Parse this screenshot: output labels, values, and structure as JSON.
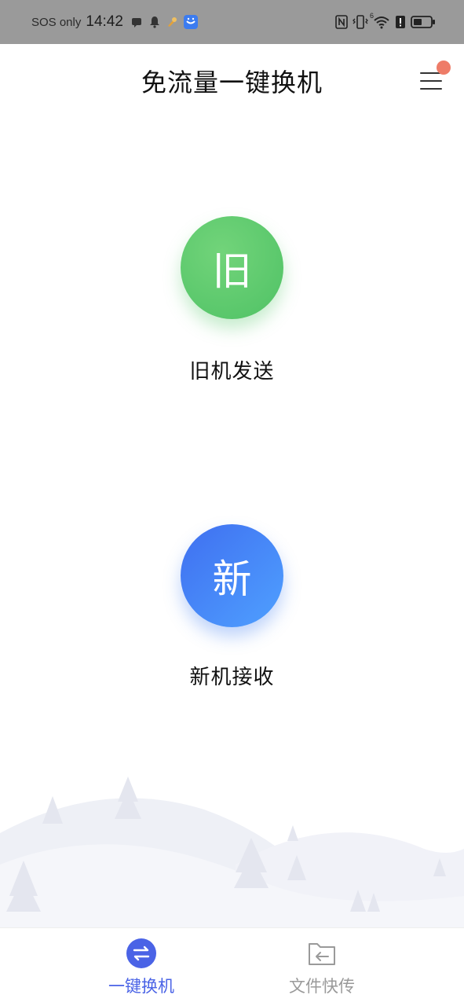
{
  "status_bar": {
    "carrier": "SOS only",
    "time": "14:42",
    "left_icons": [
      "message-icon",
      "bell-icon",
      "brush-icon",
      "app-badge-icon"
    ],
    "right_icons": [
      "nfc-icon",
      "vibrate-icon",
      "wifi-icon",
      "alert-icon",
      "battery-icon"
    ],
    "wifi_label": "6"
  },
  "header": {
    "title": "免流量一键换机",
    "menu_icon": "hamburger-menu-icon"
  },
  "actions": {
    "old": {
      "glyph": "旧",
      "label": "旧机发送",
      "color": "#5fc96f"
    },
    "new": {
      "glyph": "新",
      "label": "新机接收",
      "color": "#4a86f3"
    }
  },
  "bottom_nav": {
    "items": [
      {
        "label": "一键换机",
        "icon": "swap-arrows-icon",
        "active": true,
        "color": "#4a63e6"
      },
      {
        "label": "文件快传",
        "icon": "folder-arrow-icon",
        "active": false,
        "color": "#9a9a9a"
      }
    ]
  }
}
